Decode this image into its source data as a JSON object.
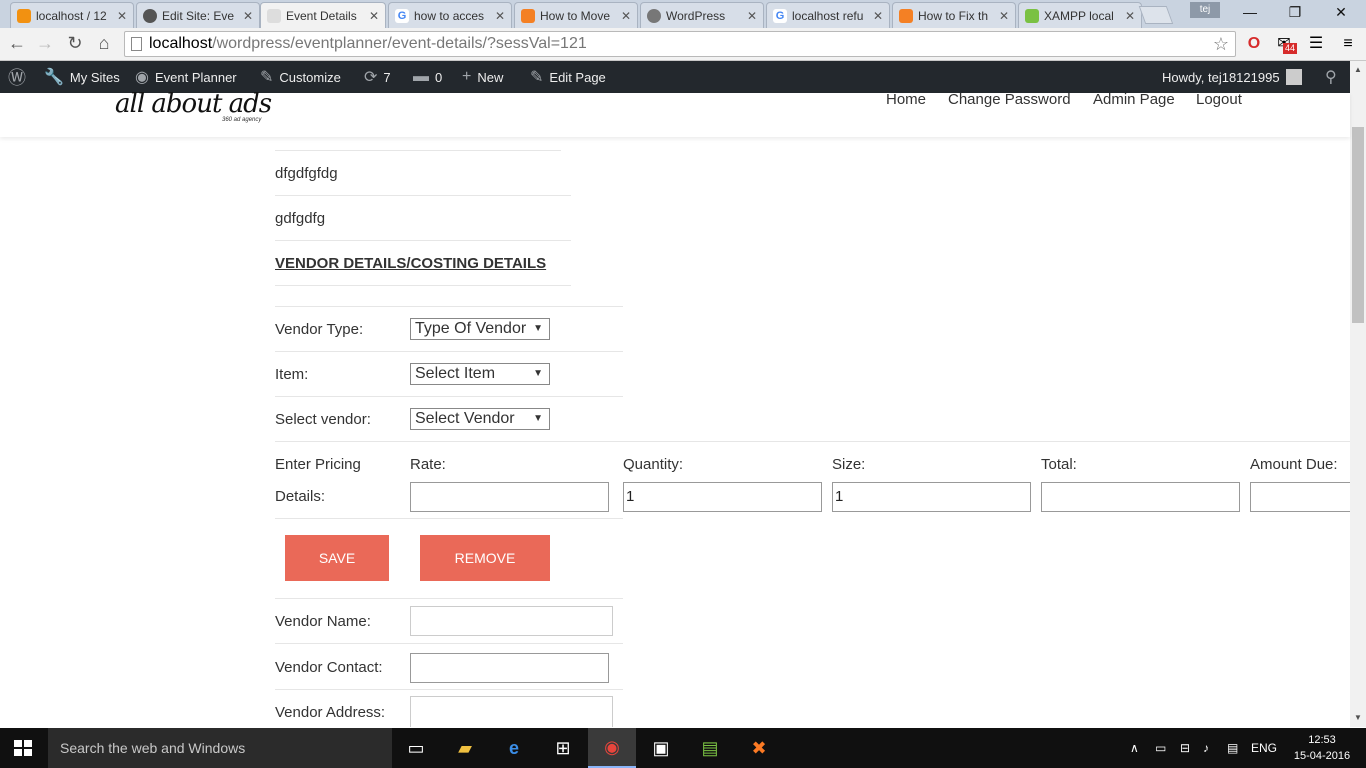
{
  "browser": {
    "tabs": [
      {
        "label": "localhost / 12",
        "favicon_color": "#f29111",
        "active": false
      },
      {
        "label": "Edit Site: Eve",
        "favicon_color": "#555555",
        "active": false
      },
      {
        "label": "Event Details",
        "favicon_color": "#999999",
        "active": true
      },
      {
        "label": "how to acces",
        "favicon_color": "#4285f4",
        "active": false
      },
      {
        "label": "How to Move",
        "favicon_color": "#f48024",
        "active": false
      },
      {
        "label": "WordPress",
        "favicon_color": "#777777",
        "active": false
      },
      {
        "label": "localhost refu",
        "favicon_color": "#4285f4",
        "active": false
      },
      {
        "label": "How to Fix th",
        "favicon_color": "#f48024",
        "active": false
      },
      {
        "label": "XAMPP local",
        "favicon_color": "#7ac143",
        "active": false
      }
    ],
    "profile_name": "tej",
    "url_host": "localhost",
    "url_path": "/wordpress/eventplanner/event-details/?sessVal=121",
    "mail_badge": "44"
  },
  "admin_bar": {
    "my_sites": "My Sites",
    "event_planner": "Event Planner",
    "customize": "Customize",
    "updates_count": "7",
    "comments_count": "0",
    "new": "New",
    "edit_page": "Edit Page",
    "howdy": "Howdy, tej18121995"
  },
  "header": {
    "logo_text": "all about ads",
    "logo_tagline": "360 ad agency",
    "nav": [
      "Home",
      "Change Password",
      "Admin Page",
      "Logout"
    ]
  },
  "event": {
    "line1": "dfgdfgfdg",
    "line2": "gdfgdfg"
  },
  "vendor_section": {
    "title": "VENDOR DETAILS/COSTING DETAILS",
    "vendor_type_label": "Vendor Type:",
    "vendor_type_value": "Type Of Vendor",
    "item_label": "Item:",
    "item_value": "Select Item",
    "vendor_label": "Select vendor:",
    "vendor_value": "Select Vendor",
    "pricing_label_1": "Enter Pricing",
    "pricing_label_2": "Details:",
    "rate_label": "Rate:",
    "rate_value": "",
    "quantity_label": "Quantity:",
    "quantity_value": "1",
    "size_label": "Size:",
    "size_value": "1",
    "total_label": "Total:",
    "total_value": "",
    "amount_due_label": "Amount Due:",
    "amount_due_value": "",
    "save_label": "SAVE",
    "remove_label": "REMOVE",
    "vendor_name_label": "Vendor Name:",
    "vendor_contact_label": "Vendor Contact:",
    "vendor_address_label": "Vendor Address:"
  },
  "taskbar": {
    "search_placeholder": "Search the web and Windows",
    "language": "ENG",
    "time": "12:53",
    "date": "15-04-2016"
  },
  "colors": {
    "button": "#ea6958",
    "admin_bar": "#23282d",
    "taskbar": "#101010"
  }
}
